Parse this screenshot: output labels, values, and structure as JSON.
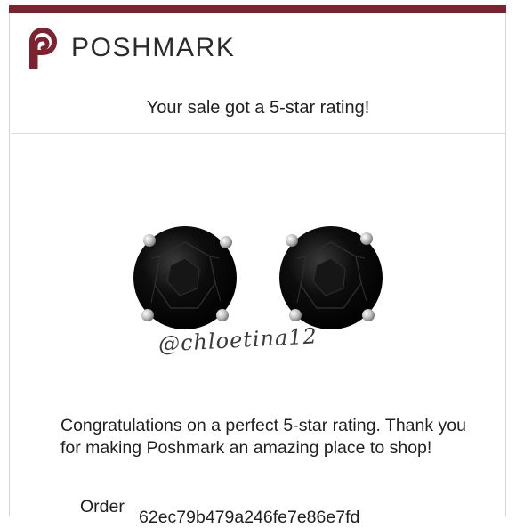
{
  "brand": {
    "name": "POSHMARK",
    "accent_color": "#7b2430"
  },
  "email": {
    "headline": "Your sale got a 5-star rating!",
    "product_image": {
      "watermark": "@chloetina12",
      "subject": "black-stud-earrings"
    },
    "message": "Congratulations on a perfect 5-star rating. Thank you for making Poshmark an amazing place to shop!",
    "order": {
      "label": "Order",
      "id": "62ec79b479a246fe7e86e7fd"
    }
  }
}
